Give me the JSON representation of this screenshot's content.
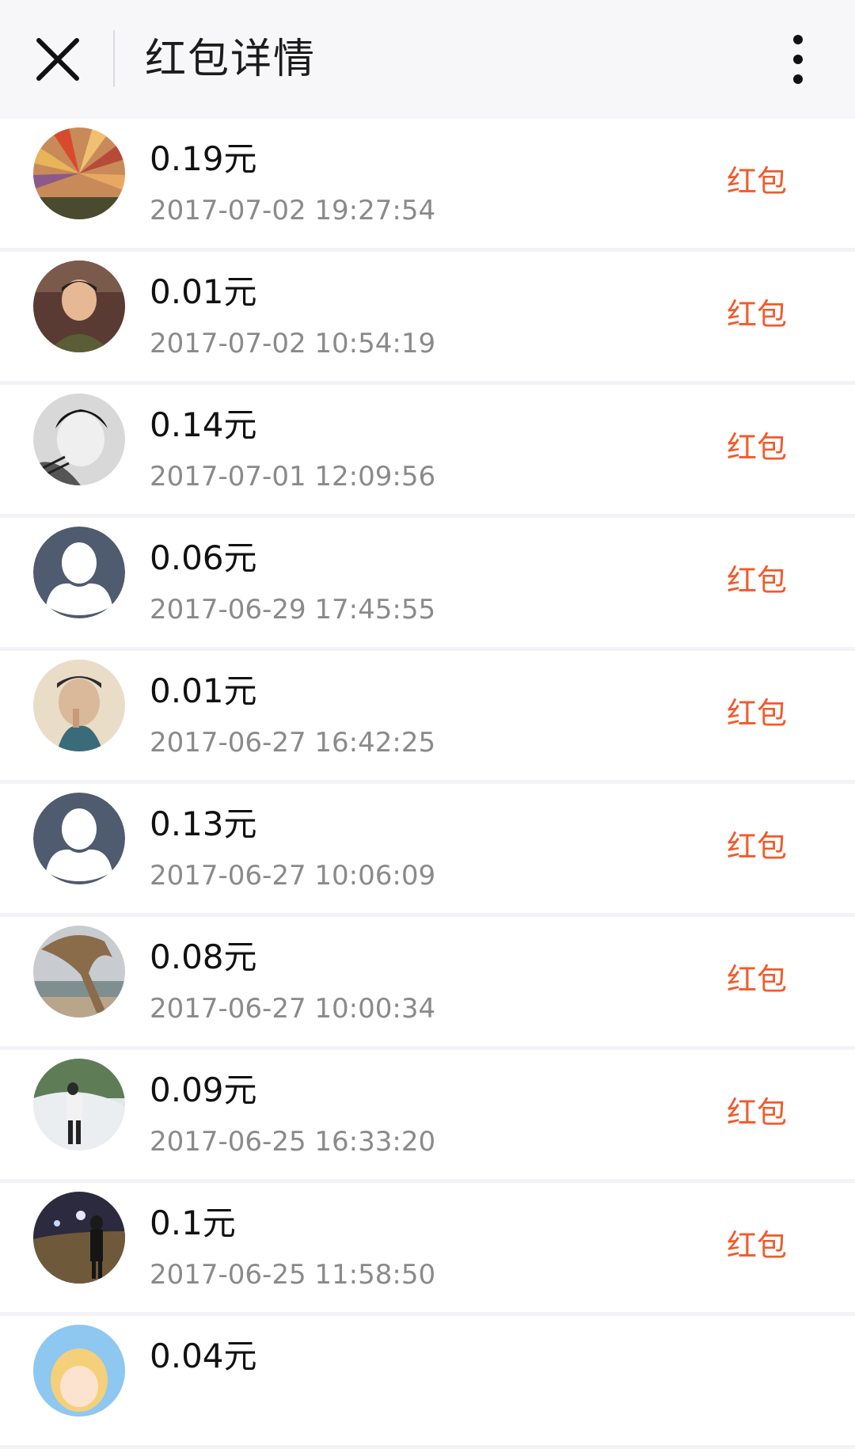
{
  "header": {
    "title": "红包详情",
    "close_icon": "close-icon",
    "more_icon": "more-vertical-icon"
  },
  "colors": {
    "accent": "#f25a2b",
    "default_avatar": "#4f5b6e"
  },
  "records": [
    {
      "amount": "0.19元",
      "time": "2017-07-02 19:27:54",
      "tag": "红包",
      "avatar": "photo-avatar"
    },
    {
      "amount": "0.01元",
      "time": "2017-07-02 10:54:19",
      "tag": "红包",
      "avatar": "photo-avatar"
    },
    {
      "amount": "0.14元",
      "time": "2017-07-01 12:09:56",
      "tag": "红包",
      "avatar": "photo-avatar"
    },
    {
      "amount": "0.06元",
      "time": "2017-06-29 17:45:55",
      "tag": "红包",
      "avatar": "default-user-avatar"
    },
    {
      "amount": "0.01元",
      "time": "2017-06-27 16:42:25",
      "tag": "红包",
      "avatar": "photo-avatar"
    },
    {
      "amount": "0.13元",
      "time": "2017-06-27 10:06:09",
      "tag": "红包",
      "avatar": "default-user-avatar"
    },
    {
      "amount": "0.08元",
      "time": "2017-06-27 10:00:34",
      "tag": "红包",
      "avatar": "photo-avatar"
    },
    {
      "amount": "0.09元",
      "time": "2017-06-25 16:33:20",
      "tag": "红包",
      "avatar": "photo-avatar"
    },
    {
      "amount": "0.1元",
      "time": "2017-06-25 11:58:50",
      "tag": "红包",
      "avatar": "photo-avatar"
    },
    {
      "amount": "0.04元",
      "time": "",
      "tag": "",
      "avatar": "photo-avatar"
    }
  ]
}
